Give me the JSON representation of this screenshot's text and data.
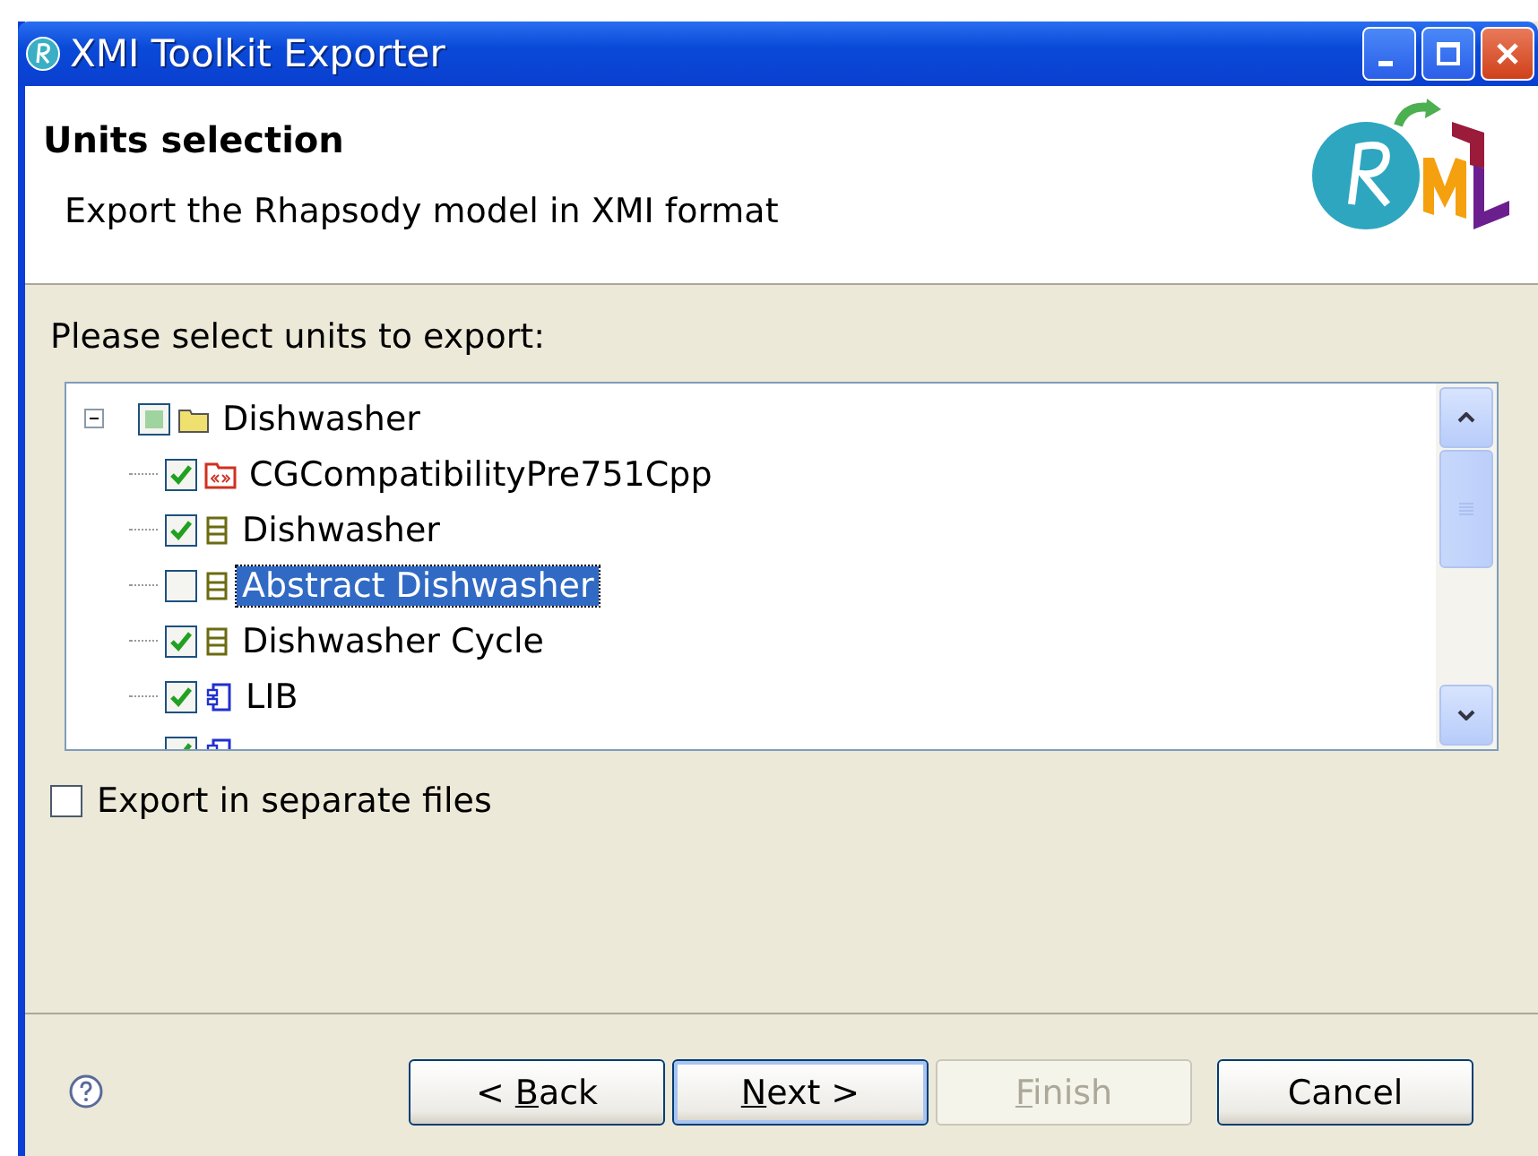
{
  "window": {
    "title": "XMI Toolkit Exporter"
  },
  "header": {
    "title": "Units selection",
    "description": "Export the Rhapsody model in XMI format"
  },
  "prompt": "Please select units to export:",
  "tree": {
    "label": "Dishwasher",
    "expanded": true,
    "checked": true,
    "grayed": true,
    "kind": "folder",
    "selected": false,
    "children": [
      {
        "label": "CGCompatibilityPre751Cpp",
        "kind": "profile",
        "checked": true,
        "selected": false
      },
      {
        "label": "Dishwasher",
        "kind": "class",
        "checked": true,
        "selected": false
      },
      {
        "label": "Abstract Dishwasher",
        "kind": "class",
        "checked": false,
        "selected": true
      },
      {
        "label": "Dishwasher Cycle",
        "kind": "class",
        "checked": true,
        "selected": false
      },
      {
        "label": "LIB",
        "kind": "component",
        "checked": true,
        "selected": false
      },
      {
        "kind": "component",
        "checked": true,
        "selected": false
      }
    ]
  },
  "separate_files": {
    "label": "Export in separate files",
    "checked": false
  },
  "buttons": [
    {
      "before": "< ",
      "mnemonic": "B",
      "after": "ack",
      "disabled": false,
      "default": false
    },
    {
      "mnemonic": "N",
      "after": "ext >",
      "disabled": false,
      "default": true
    },
    {
      "mnemonic": "F",
      "after": "inish",
      "disabled": true,
      "default": false
    },
    {
      "before": "Cancel",
      "disabled": false,
      "default": false
    }
  ]
}
